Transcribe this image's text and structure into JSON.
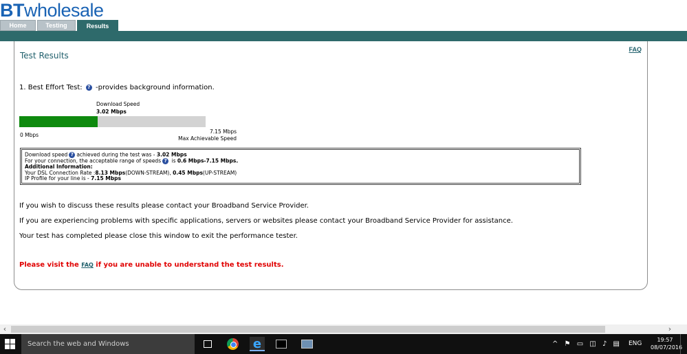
{
  "header": {
    "logo_bt": "BT",
    "logo_rest": "wholesale",
    "tabs": [
      {
        "label": "Home"
      },
      {
        "label": "Testing"
      },
      {
        "label": "Results"
      }
    ]
  },
  "panel": {
    "faq_label": "FAQ",
    "title": "Test Results",
    "best_effort": {
      "prefix": "1. Best Effort Test:",
      "suffix": "-provides background information."
    },
    "speed_bar": {
      "label": "Download  Speed",
      "value_text": "3.02 Mbps",
      "value": 3.02,
      "max": 7.15,
      "min_label": "0 Mbps",
      "max_label": "7.15 Mbps",
      "max_sub": "Max Achievable Speed",
      "fill_color": "#0e8a0e",
      "track_color": "#d3d3d3"
    },
    "info": {
      "l1_a": "Download speed",
      "l1_b": "achieved during the test was - ",
      "l1_val": "3.02 Mbps",
      "l2_a": "For your connection, the acceptable range of speeds",
      "l2_b": " is ",
      "l2_val": "0.6 Mbps-7.15 Mbps.",
      "l3": "Additional Information:",
      "l4_a": "Your DSL Connection Rate :",
      "l4_v1": "8.13 Mbps",
      "l4_b": "(DOWN-STREAM), ",
      "l4_v2": "0.45 Mbps",
      "l4_c": "(UP-STREAM)",
      "l5_a": "IP Profile for your line is - ",
      "l5_val": "7.15 Mbps"
    },
    "paragraphs": [
      "If you wish to discuss these results please contact your Broadband Service Provider.",
      "If you are experiencing problems with specific applications, servers or websites please contact your Broadband Service Provider for assistance.",
      "Your test has completed please close this window to exit the performance tester."
    ],
    "visit": {
      "pre": "Please visit the ",
      "link": "FAQ",
      "post": " if you are unable to understand the test results."
    }
  },
  "taskbar": {
    "search_placeholder": "Search the web and Windows",
    "lang": "ENG",
    "time": "19:57",
    "date": "08/07/2016"
  }
}
